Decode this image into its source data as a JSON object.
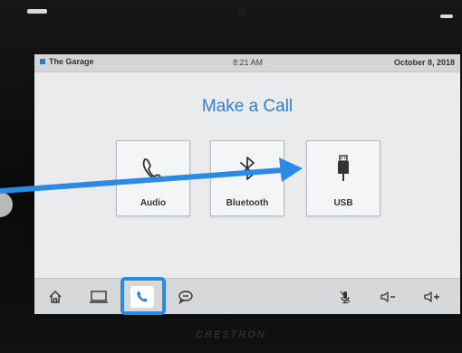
{
  "status_bar": {
    "room_name": "The Garage",
    "time": "8:21 AM",
    "date": "October 8, 2018"
  },
  "page": {
    "title": "Make a Call"
  },
  "call_options": [
    {
      "label": "Audio",
      "icon": "phone-handset-icon"
    },
    {
      "label": "Bluetooth",
      "icon": "bluetooth-icon"
    },
    {
      "label": "USB",
      "icon": "usb-icon"
    }
  ],
  "nav_bar": {
    "buttons": [
      {
        "icon": "home-icon"
      },
      {
        "icon": "laptop-icon"
      },
      {
        "icon": "phone-icon",
        "selected": true
      },
      {
        "icon": "chat-icon"
      },
      {
        "icon": "microphone-mute-icon"
      },
      {
        "icon": "volume-down-icon"
      },
      {
        "icon": "volume-up-icon"
      }
    ]
  },
  "device": {
    "brand": "CRESTRON"
  },
  "colors": {
    "accent": "#2f7fd0",
    "annotation": "#2b8ae6",
    "screen_bg": "#e9ebed"
  }
}
